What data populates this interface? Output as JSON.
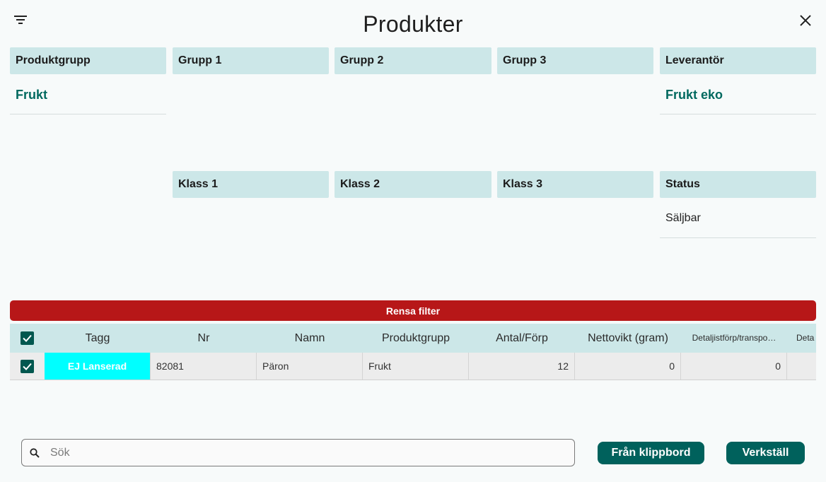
{
  "header": {
    "title": "Produkter",
    "menu_icon": "filter-list-icon",
    "close_icon": "close-icon"
  },
  "filters": {
    "produktgrupp": {
      "label": "Produktgrupp",
      "value": "Frukt"
    },
    "grupp1": {
      "label": "Grupp 1"
    },
    "grupp2": {
      "label": "Grupp 2"
    },
    "grupp3": {
      "label": "Grupp 3"
    },
    "leverantor": {
      "label": "Leverantör",
      "value": "Frukt eko"
    },
    "klass1": {
      "label": "Klass 1"
    },
    "klass2": {
      "label": "Klass 2"
    },
    "klass3": {
      "label": "Klass 3"
    },
    "status": {
      "label": "Status",
      "value": "Säljbar"
    }
  },
  "clear_filter_label": "Rensa filter",
  "table": {
    "headers": {
      "tagg": "Tagg",
      "nr": "Nr",
      "namn": "Namn",
      "produktgrupp": "Produktgrupp",
      "antal": "Antal/Förp",
      "nettovikt": "Nettovikt (gram)",
      "detaljist": "Detaljistförp/transpo…",
      "deta": "Deta"
    },
    "rows": [
      {
        "checked": true,
        "tagg": "EJ Lanserad",
        "nr": "82081",
        "namn": "Päron",
        "produktgrupp": "Frukt",
        "antal": "12",
        "nettovikt": "0",
        "detaljist": "0",
        "deta": ""
      }
    ]
  },
  "search": {
    "placeholder": "Sök",
    "value": ""
  },
  "buttons": {
    "from_clipboard": "Från klippbord",
    "apply": "Verkställ"
  },
  "colors": {
    "accent": "#00615c",
    "header_bg": "#cce7e8",
    "danger": "#b71718",
    "tag_bg": "#00ffff"
  }
}
